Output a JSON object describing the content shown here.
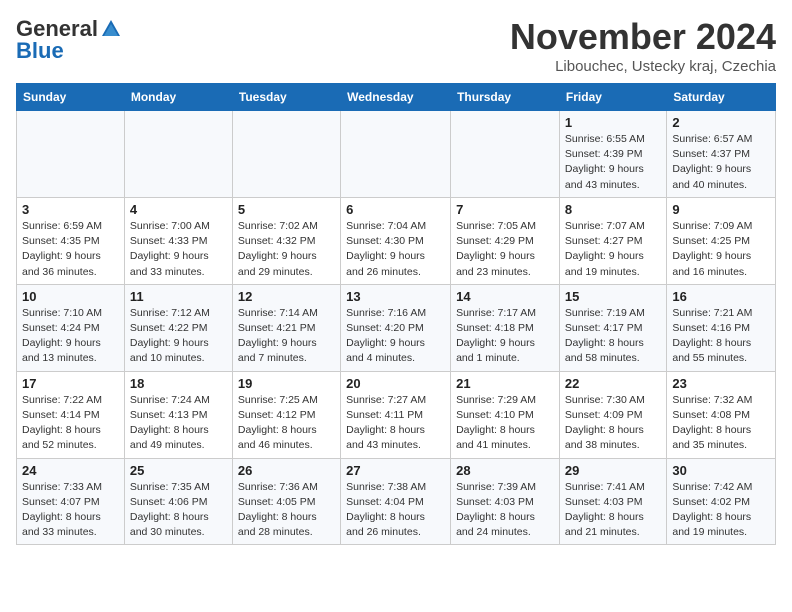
{
  "header": {
    "logo_general": "General",
    "logo_blue": "Blue",
    "month_title": "November 2024",
    "location": "Libouchec, Ustecky kraj, Czechia"
  },
  "columns": [
    "Sunday",
    "Monday",
    "Tuesday",
    "Wednesday",
    "Thursday",
    "Friday",
    "Saturday"
  ],
  "weeks": [
    [
      {
        "day": "",
        "detail": ""
      },
      {
        "day": "",
        "detail": ""
      },
      {
        "day": "",
        "detail": ""
      },
      {
        "day": "",
        "detail": ""
      },
      {
        "day": "",
        "detail": ""
      },
      {
        "day": "1",
        "detail": "Sunrise: 6:55 AM\nSunset: 4:39 PM\nDaylight: 9 hours\nand 43 minutes."
      },
      {
        "day": "2",
        "detail": "Sunrise: 6:57 AM\nSunset: 4:37 PM\nDaylight: 9 hours\nand 40 minutes."
      }
    ],
    [
      {
        "day": "3",
        "detail": "Sunrise: 6:59 AM\nSunset: 4:35 PM\nDaylight: 9 hours\nand 36 minutes."
      },
      {
        "day": "4",
        "detail": "Sunrise: 7:00 AM\nSunset: 4:33 PM\nDaylight: 9 hours\nand 33 minutes."
      },
      {
        "day": "5",
        "detail": "Sunrise: 7:02 AM\nSunset: 4:32 PM\nDaylight: 9 hours\nand 29 minutes."
      },
      {
        "day": "6",
        "detail": "Sunrise: 7:04 AM\nSunset: 4:30 PM\nDaylight: 9 hours\nand 26 minutes."
      },
      {
        "day": "7",
        "detail": "Sunrise: 7:05 AM\nSunset: 4:29 PM\nDaylight: 9 hours\nand 23 minutes."
      },
      {
        "day": "8",
        "detail": "Sunrise: 7:07 AM\nSunset: 4:27 PM\nDaylight: 9 hours\nand 19 minutes."
      },
      {
        "day": "9",
        "detail": "Sunrise: 7:09 AM\nSunset: 4:25 PM\nDaylight: 9 hours\nand 16 minutes."
      }
    ],
    [
      {
        "day": "10",
        "detail": "Sunrise: 7:10 AM\nSunset: 4:24 PM\nDaylight: 9 hours\nand 13 minutes."
      },
      {
        "day": "11",
        "detail": "Sunrise: 7:12 AM\nSunset: 4:22 PM\nDaylight: 9 hours\nand 10 minutes."
      },
      {
        "day": "12",
        "detail": "Sunrise: 7:14 AM\nSunset: 4:21 PM\nDaylight: 9 hours\nand 7 minutes."
      },
      {
        "day": "13",
        "detail": "Sunrise: 7:16 AM\nSunset: 4:20 PM\nDaylight: 9 hours\nand 4 minutes."
      },
      {
        "day": "14",
        "detail": "Sunrise: 7:17 AM\nSunset: 4:18 PM\nDaylight: 9 hours\nand 1 minute."
      },
      {
        "day": "15",
        "detail": "Sunrise: 7:19 AM\nSunset: 4:17 PM\nDaylight: 8 hours\nand 58 minutes."
      },
      {
        "day": "16",
        "detail": "Sunrise: 7:21 AM\nSunset: 4:16 PM\nDaylight: 8 hours\nand 55 minutes."
      }
    ],
    [
      {
        "day": "17",
        "detail": "Sunrise: 7:22 AM\nSunset: 4:14 PM\nDaylight: 8 hours\nand 52 minutes."
      },
      {
        "day": "18",
        "detail": "Sunrise: 7:24 AM\nSunset: 4:13 PM\nDaylight: 8 hours\nand 49 minutes."
      },
      {
        "day": "19",
        "detail": "Sunrise: 7:25 AM\nSunset: 4:12 PM\nDaylight: 8 hours\nand 46 minutes."
      },
      {
        "day": "20",
        "detail": "Sunrise: 7:27 AM\nSunset: 4:11 PM\nDaylight: 8 hours\nand 43 minutes."
      },
      {
        "day": "21",
        "detail": "Sunrise: 7:29 AM\nSunset: 4:10 PM\nDaylight: 8 hours\nand 41 minutes."
      },
      {
        "day": "22",
        "detail": "Sunrise: 7:30 AM\nSunset: 4:09 PM\nDaylight: 8 hours\nand 38 minutes."
      },
      {
        "day": "23",
        "detail": "Sunrise: 7:32 AM\nSunset: 4:08 PM\nDaylight: 8 hours\nand 35 minutes."
      }
    ],
    [
      {
        "day": "24",
        "detail": "Sunrise: 7:33 AM\nSunset: 4:07 PM\nDaylight: 8 hours\nand 33 minutes."
      },
      {
        "day": "25",
        "detail": "Sunrise: 7:35 AM\nSunset: 4:06 PM\nDaylight: 8 hours\nand 30 minutes."
      },
      {
        "day": "26",
        "detail": "Sunrise: 7:36 AM\nSunset: 4:05 PM\nDaylight: 8 hours\nand 28 minutes."
      },
      {
        "day": "27",
        "detail": "Sunrise: 7:38 AM\nSunset: 4:04 PM\nDaylight: 8 hours\nand 26 minutes."
      },
      {
        "day": "28",
        "detail": "Sunrise: 7:39 AM\nSunset: 4:03 PM\nDaylight: 8 hours\nand 24 minutes."
      },
      {
        "day": "29",
        "detail": "Sunrise: 7:41 AM\nSunset: 4:03 PM\nDaylight: 8 hours\nand 21 minutes."
      },
      {
        "day": "30",
        "detail": "Sunrise: 7:42 AM\nSunset: 4:02 PM\nDaylight: 8 hours\nand 19 minutes."
      }
    ]
  ]
}
